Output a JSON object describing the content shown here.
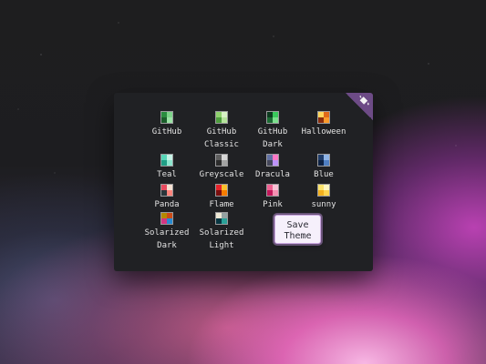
{
  "popup": {
    "corner_icon": "paint-bucket-icon",
    "corner_color": "#6d4b86"
  },
  "themes": [
    {
      "label": "GitHub",
      "colors": [
        "#2a8d3f",
        "#7ed48a",
        "#1b5e2b",
        "#9be3a5"
      ]
    },
    {
      "label": "GitHub\nClassic",
      "colors": [
        "#8fd16d",
        "#d7f2c5",
        "#4d9d3d",
        "#b5e39b"
      ]
    },
    {
      "label": "GitHub\nDark",
      "colors": [
        "#0d3a1f",
        "#39c95b",
        "#1b6b33",
        "#7be08d"
      ]
    },
    {
      "label": "Halloween",
      "colors": [
        "#fdd65c",
        "#e06a19",
        "#8a2d0c",
        "#fb9a2a"
      ]
    },
    {
      "label": "Teal",
      "colors": [
        "#57d6b8",
        "#c6f2e6",
        "#1f9e86",
        "#8ee6cf"
      ]
    },
    {
      "label": "Greyscale",
      "colors": [
        "#5e5e5e",
        "#d7d7d7",
        "#2c2c2c",
        "#a3a3a3"
      ]
    },
    {
      "label": "Dracula",
      "colors": [
        "#6272a4",
        "#ff79c6",
        "#44475a",
        "#bd93f9"
      ]
    },
    {
      "label": "Blue",
      "colors": [
        "#1f3d6b",
        "#8fb5e8",
        "#0d2244",
        "#4f7fc2"
      ]
    },
    {
      "label": "Panda",
      "colors": [
        "#e84a5f",
        "#f6e1d3",
        "#2a363b",
        "#ff847c"
      ]
    },
    {
      "label": "Flame",
      "colors": [
        "#e7232b",
        "#fbc02d",
        "#7a0f0f",
        "#f57c00"
      ]
    },
    {
      "label": "Pink",
      "colors": [
        "#f06292",
        "#fbc2d6",
        "#c2185b",
        "#f48fb1"
      ]
    },
    {
      "label": "sunny",
      "colors": [
        "#fbe36b",
        "#fff7c2",
        "#f2b01e",
        "#ffd54f"
      ]
    },
    {
      "label": "Solarized\nDark",
      "colors": [
        "#b58900",
        "#cb4b16",
        "#d33682",
        "#268bd2"
      ]
    },
    {
      "label": "Solarized\nLight",
      "colors": [
        "#eee8d5",
        "#93a1a1",
        "#073642",
        "#2aa198"
      ]
    }
  ],
  "save_button": {
    "label": "Save\nTheme"
  }
}
